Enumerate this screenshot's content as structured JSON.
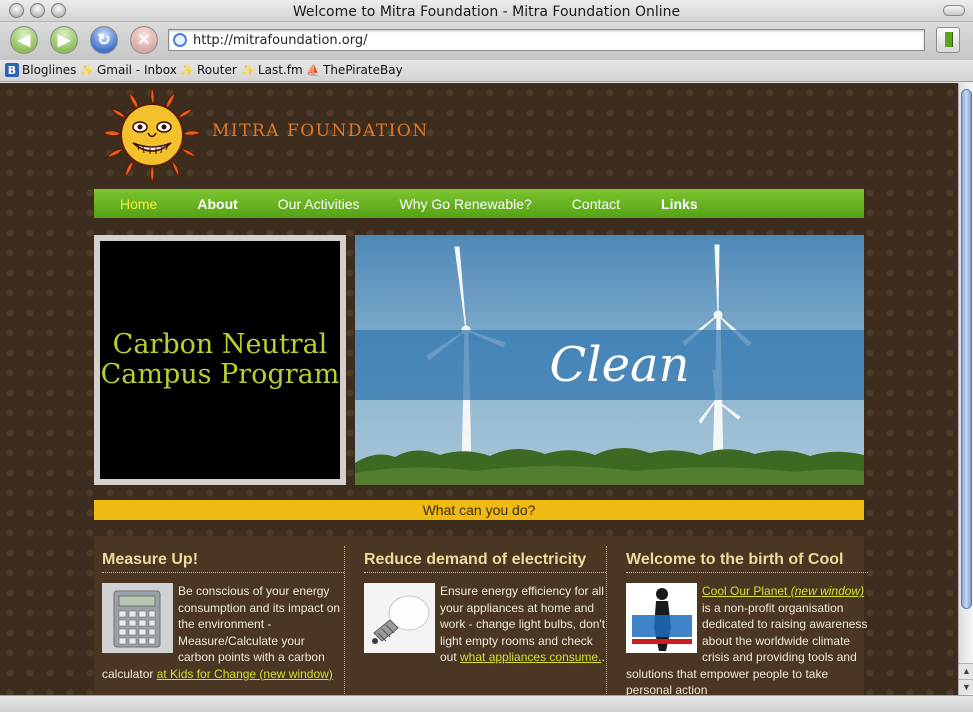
{
  "window": {
    "title": "Welcome to Mitra Foundation - Mitra Foundation Online"
  },
  "toolbar": {
    "url": "http://mitrafoundation.org/"
  },
  "bookmarks": [
    {
      "label": "Bloglines",
      "icon": "bloglines-icon"
    },
    {
      "label": "Gmail - Inbox",
      "icon": "leaf-icon"
    },
    {
      "label": "Router",
      "icon": "leaf-icon"
    },
    {
      "label": "Last.fm",
      "icon": "leaf-icon"
    },
    {
      "label": "ThePirateBay",
      "icon": "pirate-ship-icon"
    }
  ],
  "site": {
    "logo_text": "MITRA FOUNDATION",
    "nav": [
      {
        "label": "Home",
        "active": true
      },
      {
        "label": "About"
      },
      {
        "label": "Our Activities"
      },
      {
        "label": "Why Go Renewable?"
      },
      {
        "label": "Contact"
      },
      {
        "label": "Links"
      }
    ],
    "promo": {
      "line1": "Carbon Neutral",
      "line2": "Campus Program"
    },
    "hero_word": "Clean",
    "strip_text": "What can you do?",
    "columns": [
      {
        "title": "Measure Up!",
        "image": "calculator-image",
        "text": "Be conscious of your energy consumption and its impact on the environment - Measure/Calculate your carbon points with a carbon calculator ",
        "link_text": "at Kids for Change (new window)",
        "after_link": ""
      },
      {
        "title": "Reduce demand of electricity",
        "image": "light-bulb-image",
        "text": "Ensure energy efficiency for all your appliances at home and work - change light bulbs, don't light empty rooms and check out ",
        "link_text": "what appliances consume.",
        "after_link": "."
      },
      {
        "title": "Welcome to the birth of Cool",
        "image": "cool-our-planet-image",
        "text": "",
        "link_text": "Cool Our Planet",
        "link_suffix": "(new window)",
        "after_link": " is a non-profit organisation dedicated to raising awareness about the worldwide climate crisis and providing tools and solutions that empower people to take personal action"
      }
    ]
  },
  "colors": {
    "page_bg": "#3d2d1f",
    "nav_green": "#5ca71a",
    "nav_active": "#f3ef3a",
    "strip_yellow": "#efbb12",
    "link_color": "#d2e12f",
    "logo_orange": "#e2762a",
    "promo_text": "#b5d22f"
  }
}
